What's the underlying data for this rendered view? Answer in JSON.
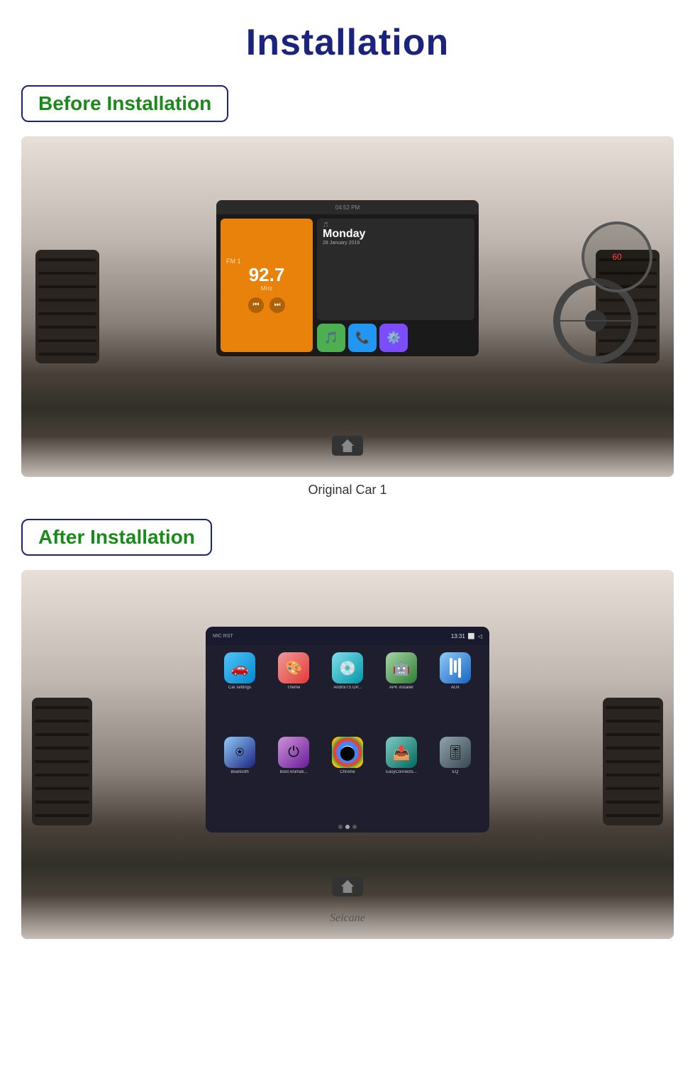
{
  "page": {
    "title": "Installation",
    "before_label": "Before Installation",
    "after_label": "After Installation",
    "caption": "Original Car  1",
    "seicane": "Seicane"
  },
  "before_screen": {
    "time": "04:52 PM",
    "fm": "FM 1",
    "freq": "92.7",
    "mhz": "MHz",
    "day": "Monday",
    "date": "28 January 2019",
    "icons": [
      "Music",
      "Phone",
      "Connect"
    ]
  },
  "after_screen": {
    "status_left": "MIC  RST",
    "status_time": "13:31",
    "apps": [
      {
        "label": "Car settings",
        "color": "car"
      },
      {
        "label": "Theme",
        "color": "theme"
      },
      {
        "label": "AndroiTS GP...",
        "color": "android"
      },
      {
        "label": "APK installer",
        "color": "apk"
      },
      {
        "label": "AUX",
        "color": "aux"
      },
      {
        "label": "Bluetooth",
        "color": "bt"
      },
      {
        "label": "Boot Animati...",
        "color": "boot"
      },
      {
        "label": "Chrome",
        "color": "chrome"
      },
      {
        "label": "EasyConnects...",
        "color": "easy"
      },
      {
        "label": "EQ",
        "color": "eq"
      }
    ]
  }
}
